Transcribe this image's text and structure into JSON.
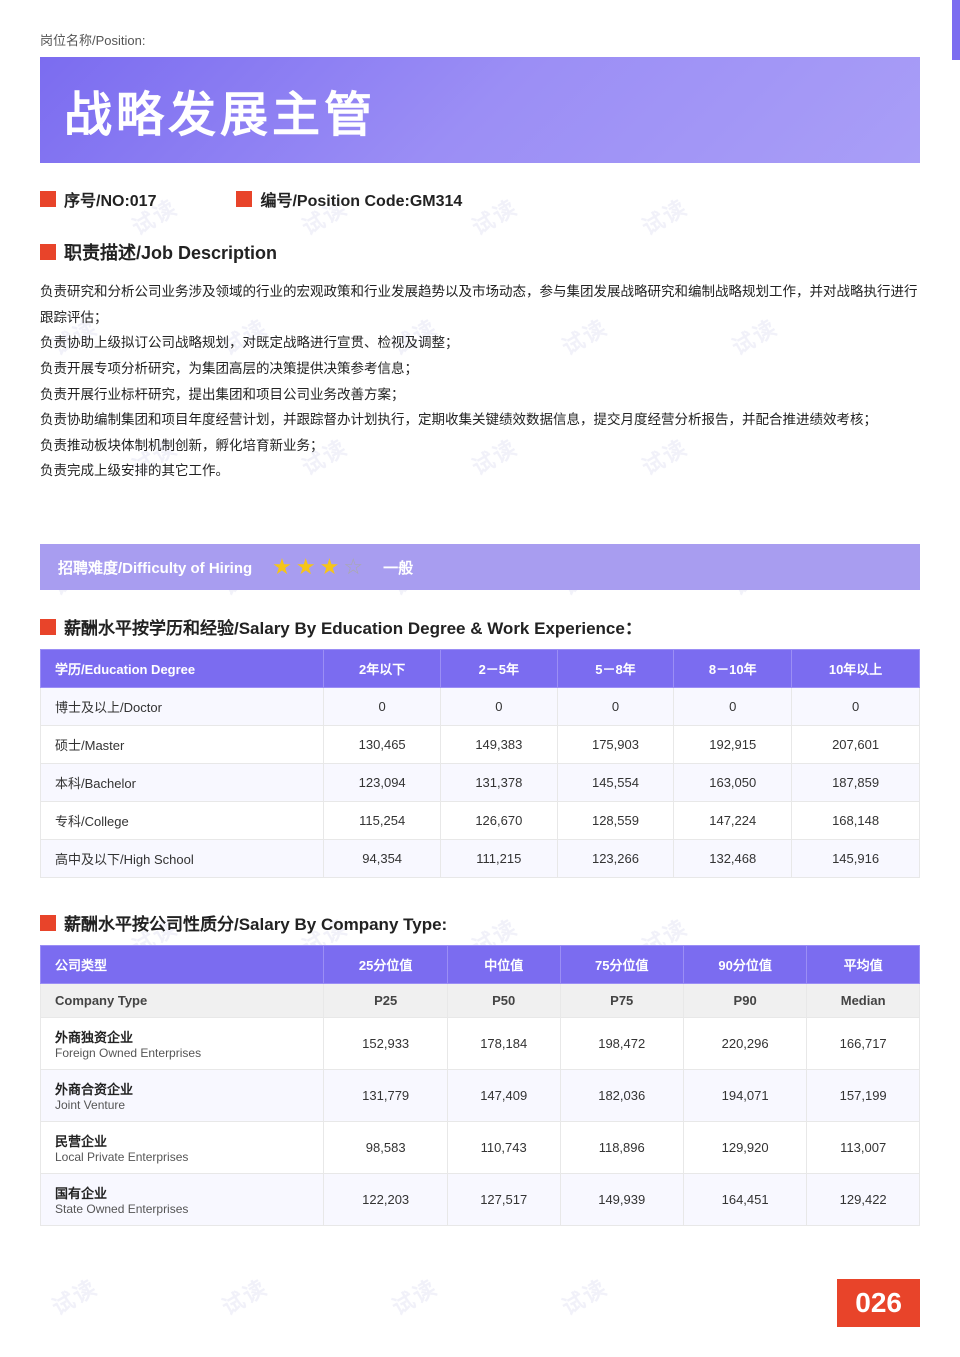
{
  "page": {
    "position_label": "岗位名称/Position:",
    "title": "战略发展主管",
    "no_label": "序号/NO:017",
    "code_label": "编号/Position Code:GM314",
    "job_description_title": "职责描述/Job Description",
    "job_description_lines": [
      "负责研究和分析公司业务涉及领域的行业的宏观政策和行业发展趋势以及市场动态，参与集团发展战略研究和编制战略规划工作，并对战略执行进行跟踪评估；",
      "负责协助上级拟订公司战略规划，对既定战略进行宣贯、检视及调整；",
      "负责开展专项分析研究，为集团高层的决策提供决策参考信息；",
      "负责开展行业标杆研究，提出集团和项目公司业务改善方案；",
      "负责协助编制集团和项目年度经营计划，并跟踪督办计划执行，定期收集关键绩效数据信息，提交月度经营分析报告，并配合推进绩效考核；",
      "负责推动板块体制机制创新，孵化培育新业务；",
      "负责完成上级安排的其它工作。"
    ],
    "hiring_difficulty_label": "招聘难度/Difficulty of Hiring",
    "stars_filled": 3,
    "stars_empty": 1,
    "difficulty_level": "一般",
    "salary_edu_title": "薪酬水平按学历和经验/Salary By Education Degree & Work Experience：",
    "salary_edu_table": {
      "headers": [
        "学历/Education Degree",
        "2年以下",
        "2－5年",
        "5－8年",
        "8－10年",
        "10年以上"
      ],
      "rows": [
        {
          "degree": "博士及以上/Doctor",
          "vals": [
            "0",
            "0",
            "0",
            "0",
            "0"
          ]
        },
        {
          "degree": "硕士/Master",
          "vals": [
            "130,465",
            "149,383",
            "175,903",
            "192,915",
            "207,601"
          ]
        },
        {
          "degree": "本科/Bachelor",
          "vals": [
            "123,094",
            "131,378",
            "145,554",
            "163,050",
            "187,859"
          ]
        },
        {
          "degree": "专科/College",
          "vals": [
            "115,254",
            "126,670",
            "128,559",
            "147,224",
            "168,148"
          ]
        },
        {
          "degree": "高中及以下/High School",
          "vals": [
            "94,354",
            "111,215",
            "123,266",
            "132,468",
            "145,916"
          ]
        }
      ]
    },
    "salary_company_title": "薪酬水平按公司性质分/Salary By Company Type:",
    "salary_company_table": {
      "headers": [
        "公司类型",
        "25分位值",
        "中位值",
        "75分位值",
        "90分位值",
        "平均值"
      ],
      "subheaders": [
        "Company Type",
        "P25",
        "P50",
        "P75",
        "P90",
        "Median"
      ],
      "rows": [
        {
          "cn": "外商独资企业",
          "en": "Foreign Owned Enterprises",
          "vals": [
            "152,933",
            "178,184",
            "198,472",
            "220,296",
            "166,717"
          ]
        },
        {
          "cn": "外商合资企业",
          "en": "Joint Venture",
          "vals": [
            "131,779",
            "147,409",
            "182,036",
            "194,071",
            "157,199"
          ]
        },
        {
          "cn": "民营企业",
          "en": "Local Private Enterprises",
          "vals": [
            "98,583",
            "110,743",
            "118,896",
            "129,920",
            "113,007"
          ]
        },
        {
          "cn": "国有企业",
          "en": "State Owned Enterprises",
          "vals": [
            "122,203",
            "127,517",
            "149,939",
            "164,451",
            "129,422"
          ]
        }
      ]
    },
    "page_number": "026"
  },
  "watermark": {
    "text": "试读"
  },
  "colors": {
    "accent_purple": "#7b6cf0",
    "accent_red": "#e8442a",
    "star_gold": "#f5c518"
  }
}
